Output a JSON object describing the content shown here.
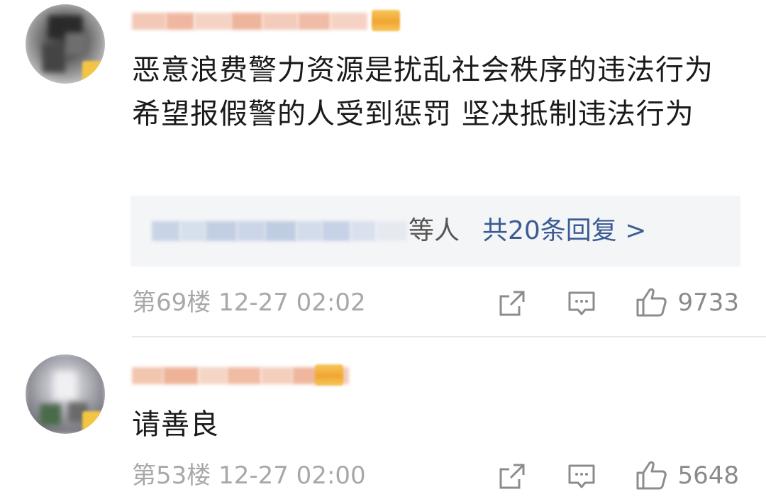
{
  "comments": [
    {
      "text": "恶意浪费警力资源是扰乱社会秩序的违法行为 希望报假警的人受到惩罚 坚决抵制违法行为",
      "replies": {
        "suffix": "等人",
        "total_label": "共20条回复 >"
      },
      "meta": "第69楼 12-27 02:02",
      "likes": "9733"
    },
    {
      "text": "请善良",
      "meta": "第53楼 12-27 02:00",
      "likes": "5648"
    }
  ],
  "icons": {
    "share": "share-icon",
    "comment": "comment-icon",
    "like": "thumbs-up-icon"
  },
  "colors": {
    "reply_link": "#3a5c93",
    "meta": "#a8a8a8",
    "text": "#1a1a1a"
  }
}
